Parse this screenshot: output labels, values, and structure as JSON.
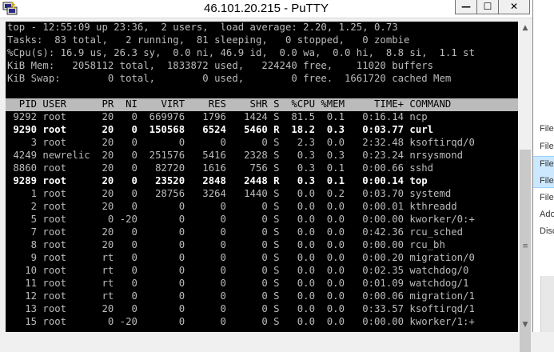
{
  "background_window": {
    "items": [
      "File f",
      "File f",
      "File f",
      "File f",
      "File f",
      "Adob",
      "Disc"
    ]
  },
  "window": {
    "title": "46.101.20.215 - PuTTY",
    "minimize_glyph": "—",
    "maximize_glyph": "☐",
    "close_glyph": "✕"
  },
  "colors": {
    "terminal_bg": "#000000",
    "terminal_fg": "#bbbbbb",
    "header_bar": "#bbbbbb"
  },
  "summary": [
    "top - 12:55:09 up 23:36,  2 users,  load average: 2.20, 1.25, 0.73",
    "Tasks:  83 total,   2 running,  81 sleeping,   0 stopped,   0 zombie",
    "%Cpu(s): 16.9 us, 26.3 sy,  0.0 ni, 46.9 id,  0.0 wa,  0.0 hi,  8.8 si,  1.1 st",
    "KiB Mem:   2058112 total,  1833872 used,   224240 free,    11020 buffers",
    "KiB Swap:        0 total,        0 used,        0 free.  1661720 cached Mem"
  ],
  "header": "  PID USER      PR  NI    VIRT    RES    SHR S  %CPU %MEM     TIME+ COMMAND",
  "processes": [
    {
      "line": " 9292 root      20   0  669976   1796   1424 S  81.5  0.1   0:16.14 ncp",
      "bold": false
    },
    {
      "line": " 9290 root      20   0  150568   6524   5460 R  18.2  0.3   0:03.77 curl",
      "bold": true
    },
    {
      "line": "    3 root      20   0       0      0      0 S   2.3  0.0   2:32.48 ksoftirqd/0",
      "bold": false
    },
    {
      "line": " 4249 newrelic  20   0  251576   5416   2328 S   0.3  0.3   0:23.24 nrsysmond",
      "bold": false
    },
    {
      "line": " 8860 root      20   0   82720   1616    756 S   0.3  0.1   0:00.66 sshd",
      "bold": false
    },
    {
      "line": " 9289 root      20   0   23520   2848   2448 R   0.3  0.1   0:00.14 top",
      "bold": true
    },
    {
      "line": "    1 root      20   0   28756   3264   1440 S   0.0  0.2   0:03.70 systemd",
      "bold": false
    },
    {
      "line": "    2 root      20   0       0      0      0 S   0.0  0.0   0:00.01 kthreadd",
      "bold": false
    },
    {
      "line": "    5 root       0 -20       0      0      0 S   0.0  0.0   0:00.00 kworker/0:+",
      "bold": false
    },
    {
      "line": "    7 root      20   0       0      0      0 S   0.0  0.0   0:42.36 rcu_sched",
      "bold": false
    },
    {
      "line": "    8 root      20   0       0      0      0 S   0.0  0.0   0:00.00 rcu_bh",
      "bold": false
    },
    {
      "line": "    9 root      rt   0       0      0      0 S   0.0  0.0   0:00.20 migration/0",
      "bold": false
    },
    {
      "line": "   10 root      rt   0       0      0      0 S   0.0  0.0   0:02.35 watchdog/0",
      "bold": false
    },
    {
      "line": "   11 root      rt   0       0      0      0 S   0.0  0.0   0:01.09 watchdog/1",
      "bold": false
    },
    {
      "line": "   12 root      rt   0       0      0      0 S   0.0  0.0   0:00.06 migration/1",
      "bold": false
    },
    {
      "line": "   13 root      20   0       0      0      0 S   0.0  0.0   0:33.57 ksoftirqd/1",
      "bold": false
    },
    {
      "line": "   15 root       0 -20       0      0      0 S   0.0  0.0   0:00.00 kworker/1:+",
      "bold": false
    }
  ],
  "scrollbar": {
    "up_glyph": "▲",
    "down_glyph": "▼",
    "grip_glyph": "≡"
  }
}
